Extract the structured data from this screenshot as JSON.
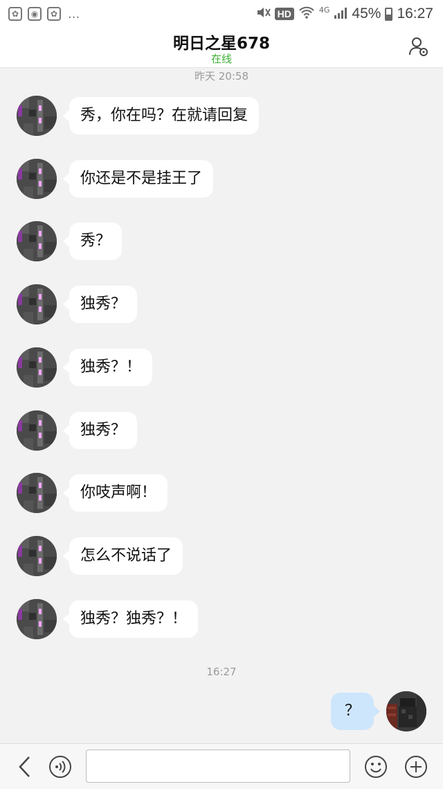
{
  "status_bar": {
    "left_icons": [
      "paw-icon",
      "wechat-icon",
      "paw-icon"
    ],
    "more": "...",
    "hd": "HD",
    "network": "4G",
    "battery": "45%",
    "battery_level": 0.45,
    "time": "16:27"
  },
  "header": {
    "title": "明日之星678",
    "status": "在线",
    "status_color": "#3cb034"
  },
  "chat": {
    "timestamp_1": "昨天 20:58",
    "incoming": [
      "秀，你在吗？在就请回复",
      "你还是不是挂王了",
      "秀？",
      "独秀？",
      "独秀？！",
      "独秀？",
      "你吱声啊！",
      "怎么不说话了",
      "独秀？独秀？！"
    ],
    "timestamp_2": "16:27",
    "outgoing": [
      "？"
    ]
  },
  "input_bar": {
    "text": "",
    "icons": [
      "back-icon",
      "voice-icon",
      "emoji-icon",
      "plus-icon"
    ]
  }
}
